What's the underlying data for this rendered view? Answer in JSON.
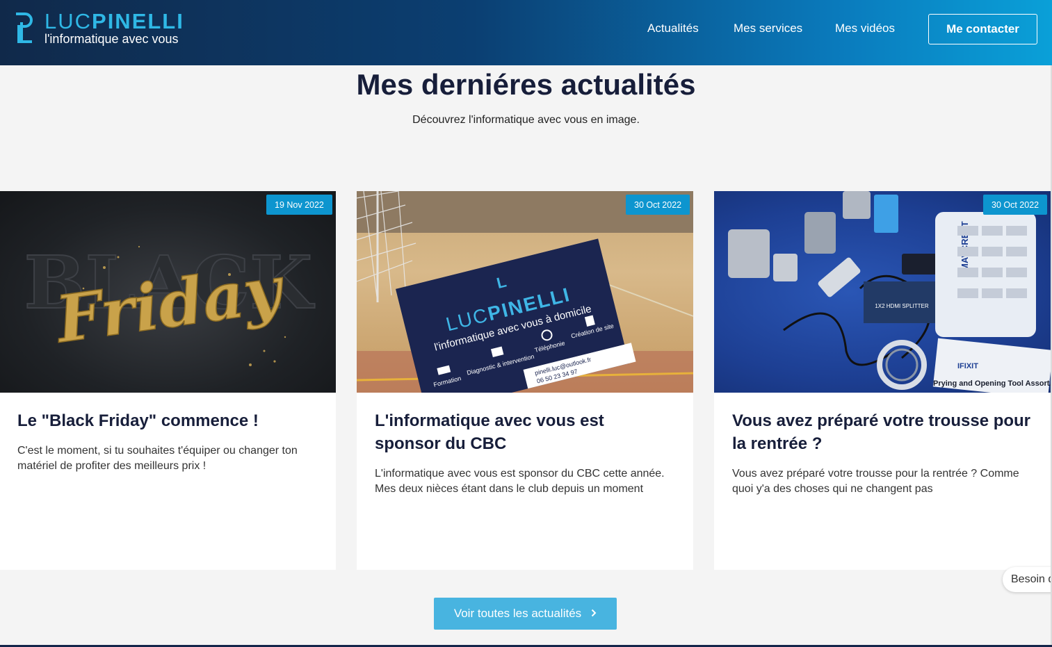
{
  "header": {
    "brand_part1": "LUC",
    "brand_part2": "PINELLI",
    "tagline": "l'informatique avec vous",
    "nav": [
      {
        "label": "Actualités"
      },
      {
        "label": "Mes services"
      },
      {
        "label": "Mes vidéos"
      }
    ],
    "cta_label": "Me contacter"
  },
  "section": {
    "title": "Mes derniéres actualités",
    "subtitle": "Découvrez l'informatique avec vous en image."
  },
  "cards": [
    {
      "date": "19 Nov 2022",
      "title": "Le \"Black Friday\" commence !",
      "excerpt": "C'est le moment, si tu souhaites t'équiper ou changer ton matériel de profiter des meilleurs prix !",
      "image_icon": "black-friday-image",
      "image_text_big": "BLACK",
      "image_text_script": "Friday"
    },
    {
      "date": "30 Oct 2022",
      "title": "L'informatique avec vous est sponsor du CBC",
      "excerpt": "L'informatique avec vous est sponsor du CBC cette année. Mes deux nièces étant dans le club depuis un moment",
      "image_icon": "sponsor-banner-image",
      "sign_brand_1": "LUC",
      "sign_brand_2": "PINELLI",
      "sign_tagline": "l'informatique avec vous à domicile",
      "sign_items": [
        "Formation",
        "Diagnostic & intervention",
        "Téléphonie",
        "Création de site"
      ],
      "sign_email": "pinelli.luc@outlook.fr",
      "sign_phone": "06 50 23 34 97"
    },
    {
      "date": "30 Oct 2022",
      "title": "Vous avez préparé votre trousse pour la rentrée ?",
      "excerpt": "Vous avez préparé votre trousse pour la rentrée ? Comme quoi y'a des choses qui ne changent pas",
      "image_icon": "tech-kit-image",
      "kit_label_1": "IFIXIT",
      "kit_label_2": "Prying and Opening Tool Assort...",
      "kit_label_3": "MAVCREAT",
      "kit_label_4": "1X2 HDMI SPLITTER"
    }
  ],
  "see_all_label": "Voir toutes les actualités",
  "chat_label": "Besoin d",
  "colors": {
    "accent": "#0d95cf",
    "button": "#48b4e0",
    "title": "#171e3a",
    "header_dark": "#10294a",
    "header_light": "#0aa0d8"
  }
}
